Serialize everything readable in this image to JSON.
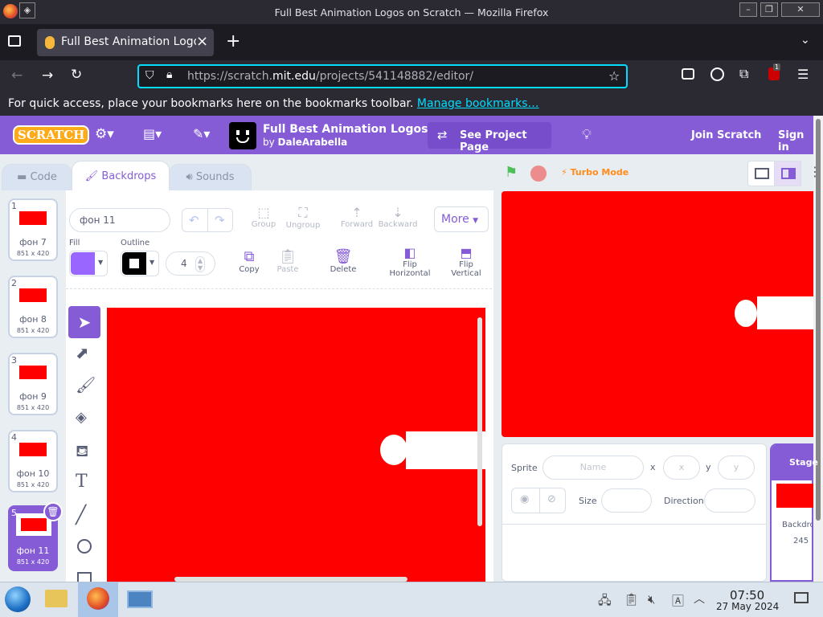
{
  "window": {
    "title": "Full Best Animation Logos on Scratch — Mozilla Firefox"
  },
  "browser": {
    "tab_title": "Full Best Animation Logos",
    "tab_close": "×",
    "new_tab": "+",
    "url_prefix": "https://scratch.",
    "url_domain": "mit.edu",
    "url_path": "/projects/541148882/editor/",
    "bookmarks_msg": "For quick access, place your bookmarks here on the bookmarks toolbar.",
    "bookmarks_link": "Manage bookmarks…",
    "extension_badge": "1"
  },
  "scratch": {
    "logo": "SCRATCH",
    "project_title": "Full Best Animation Logos",
    "by": "by",
    "author": "DaleArabella",
    "see_project": "See Project Page",
    "join": "Join Scratch",
    "signin": "Sign in",
    "turbo": "Turbo Mode"
  },
  "editor": {
    "tabs": {
      "code": "Code",
      "backdrops": "Backdrops",
      "sounds": "Sounds"
    },
    "backdrops": [
      {
        "num": "1",
        "name": "фон 7",
        "dims": "851 x 420"
      },
      {
        "num": "2",
        "name": "фон 8",
        "dims": "851 x 420"
      },
      {
        "num": "3",
        "name": "фон 9",
        "dims": "851 x 420"
      },
      {
        "num": "4",
        "name": "фон 10",
        "dims": "851 x 420"
      },
      {
        "num": "5",
        "name": "фон 11",
        "dims": "851 x 420"
      }
    ],
    "costume_name": "фон 11",
    "group": "Group",
    "ungroup": "Ungroup",
    "forward": "Forward",
    "backward": "Backward",
    "more": "More",
    "fill_label": "Fill",
    "fill_color": "#9966ff",
    "outline_label": "Outline",
    "outline_width": "4",
    "copy": "Copy",
    "paste": "Paste",
    "delete": "Delete",
    "flip_h_1": "Flip",
    "flip_h_2": "Horizontal",
    "flip_v_1": "Flip",
    "flip_v_2": "Vertical"
  },
  "sprite_info": {
    "sprite_label": "Sprite",
    "name_placeholder": "Name",
    "x_label": "x",
    "x_placeholder": "x",
    "y_label": "y",
    "y_placeholder": "y",
    "size_label": "Size",
    "direction_label": "Direction"
  },
  "stage_pane": {
    "title": "Stage",
    "backdrops_label": "Backdrop",
    "backdrops_count": "245"
  },
  "taskbar": {
    "time": "07:50",
    "date": "27 May 2024"
  },
  "colors": {
    "scratch_purple": "#855cd6",
    "canvas_red": "#ff0000"
  }
}
